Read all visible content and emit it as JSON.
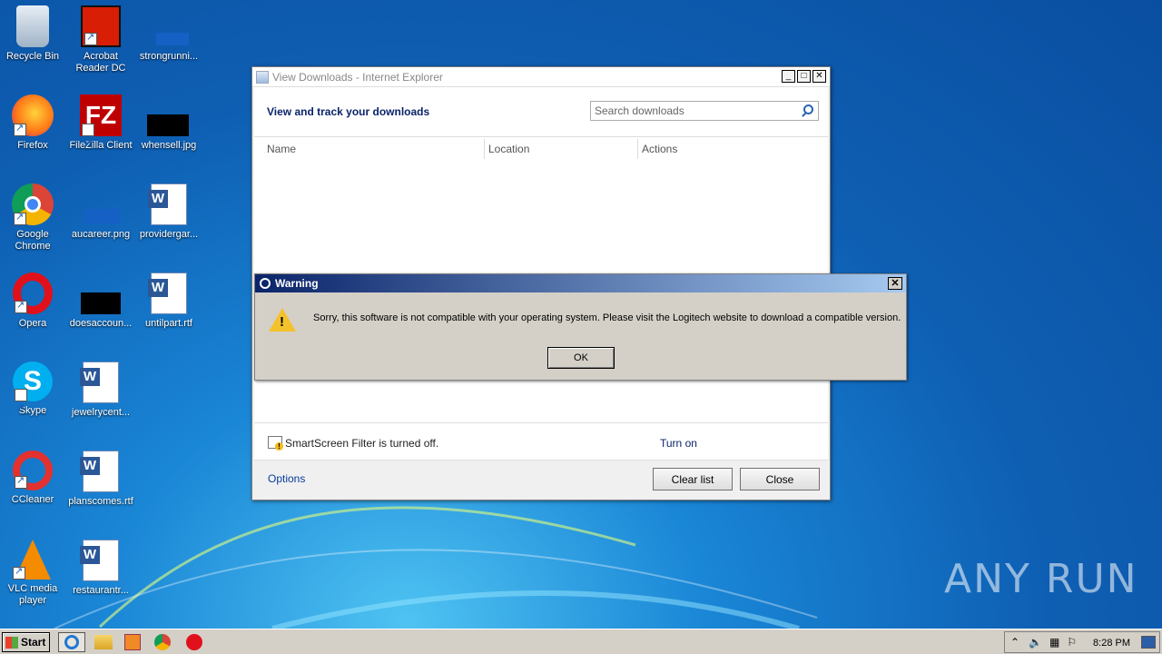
{
  "desktop": {
    "icons": [
      {
        "label": "Recycle Bin"
      },
      {
        "label": "Acrobat Reader DC"
      },
      {
        "label": "strongrunni..."
      },
      {
        "label": "Firefox"
      },
      {
        "label": "FileZilla Client"
      },
      {
        "label": "whensell.jpg"
      },
      {
        "label": "Google Chrome"
      },
      {
        "label": "aucareer.png"
      },
      {
        "label": "providergar..."
      },
      {
        "label": "Opera"
      },
      {
        "label": "doesaccoun..."
      },
      {
        "label": "untilpart.rtf"
      },
      {
        "label": "Skype"
      },
      {
        "label": "jewelrycent..."
      },
      {
        "label": "CCleaner"
      },
      {
        "label": "planscomes.rtf"
      },
      {
        "label": "VLC media player"
      },
      {
        "label": "restaurantr..."
      }
    ]
  },
  "ie_window": {
    "title": "View Downloads - Internet Explorer",
    "heading": "View and track your downloads",
    "search_placeholder": "Search downloads",
    "columns": [
      "Name",
      "Location",
      "Actions"
    ],
    "smartscreen_text": "SmartScreen Filter is turned off.",
    "turn_on_label": "Turn on",
    "options_label": "Options",
    "clear_list_label": "Clear list",
    "close_label": "Close"
  },
  "warning": {
    "title": "Warning",
    "message": "Sorry, this software is not compatible with your operating system.  Please visit the Logitech website to download a compatible version.",
    "ok_label": "OK"
  },
  "watermark": "ANY RUN",
  "taskbar": {
    "start_label": "Start",
    "clock": "8:28 PM"
  },
  "colors": {
    "warning_title_start": "#0a246a",
    "warning_title_end": "#a6caf0",
    "link": "#0a246a"
  }
}
